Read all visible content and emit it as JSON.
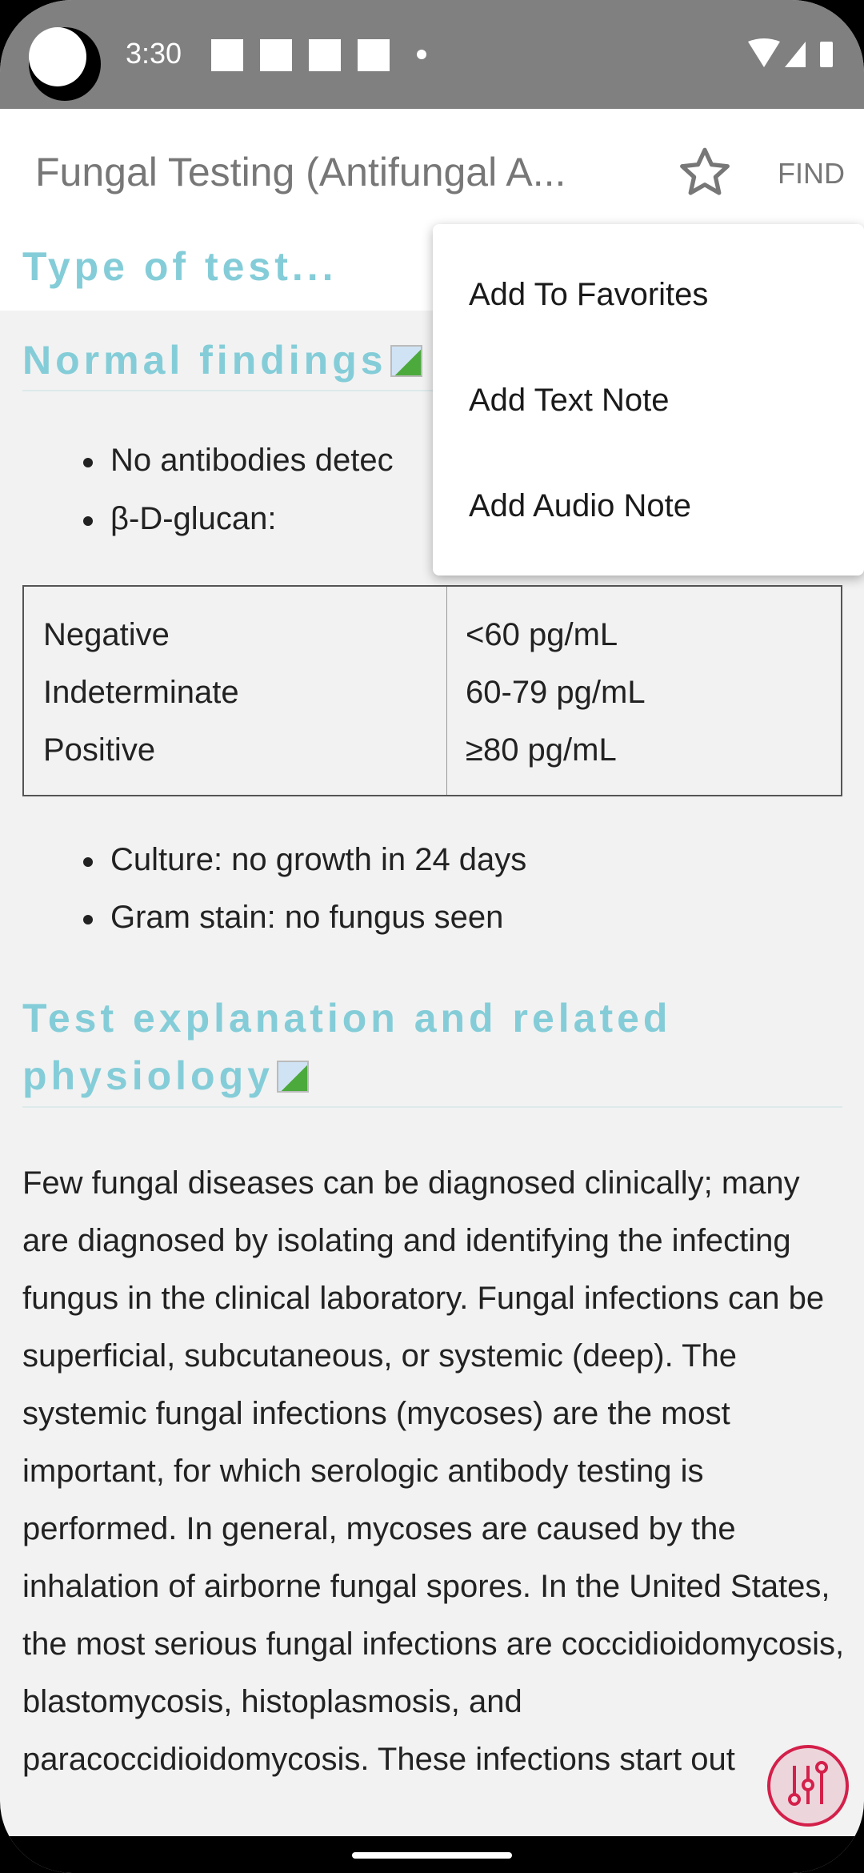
{
  "status": {
    "time": "3:30"
  },
  "appbar": {
    "title": "Fungal Testing (Antifungal A...",
    "find": "FIND"
  },
  "menu": {
    "items": [
      "Add To Favorites",
      "Add Text Note",
      "Add Audio Note"
    ]
  },
  "content": {
    "type_heading": "Type of test...",
    "normal_heading": "Normal findings",
    "bullets1": [
      "No antibodies detec",
      "β-D-glucan:"
    ],
    "table": {
      "rows": [
        [
          "Negative",
          "<60 pg/mL"
        ],
        [
          "Indeterminate",
          "60-79 pg/mL"
        ],
        [
          "Positive",
          "≥80 pg/mL"
        ]
      ]
    },
    "bullets2": [
      "Culture: no growth in 24 days",
      "Gram stain: no fungus seen"
    ],
    "explanation_heading": "Test explanation and related physiology",
    "paragraph": "Few fungal diseases can be diagnosed clinically; many are diagnosed by isolating and identifying the infecting fungus in the clinical laboratory. Fungal infections can be superficial, subcutaneous, or systemic (deep). The systemic fungal infections (mycoses) are the most important, for which serologic antibody testing is performed. In general, mycoses are caused by the inhalation of airborne fungal spores. In the United States, the most serious fungal infections are coccidioidomycosis, blastomycosis, histoplasmosis, and paracoccidioidomycosis. These infections start out"
  },
  "colors": {
    "heading": "#84cdd8",
    "fab": "#d3204a"
  }
}
